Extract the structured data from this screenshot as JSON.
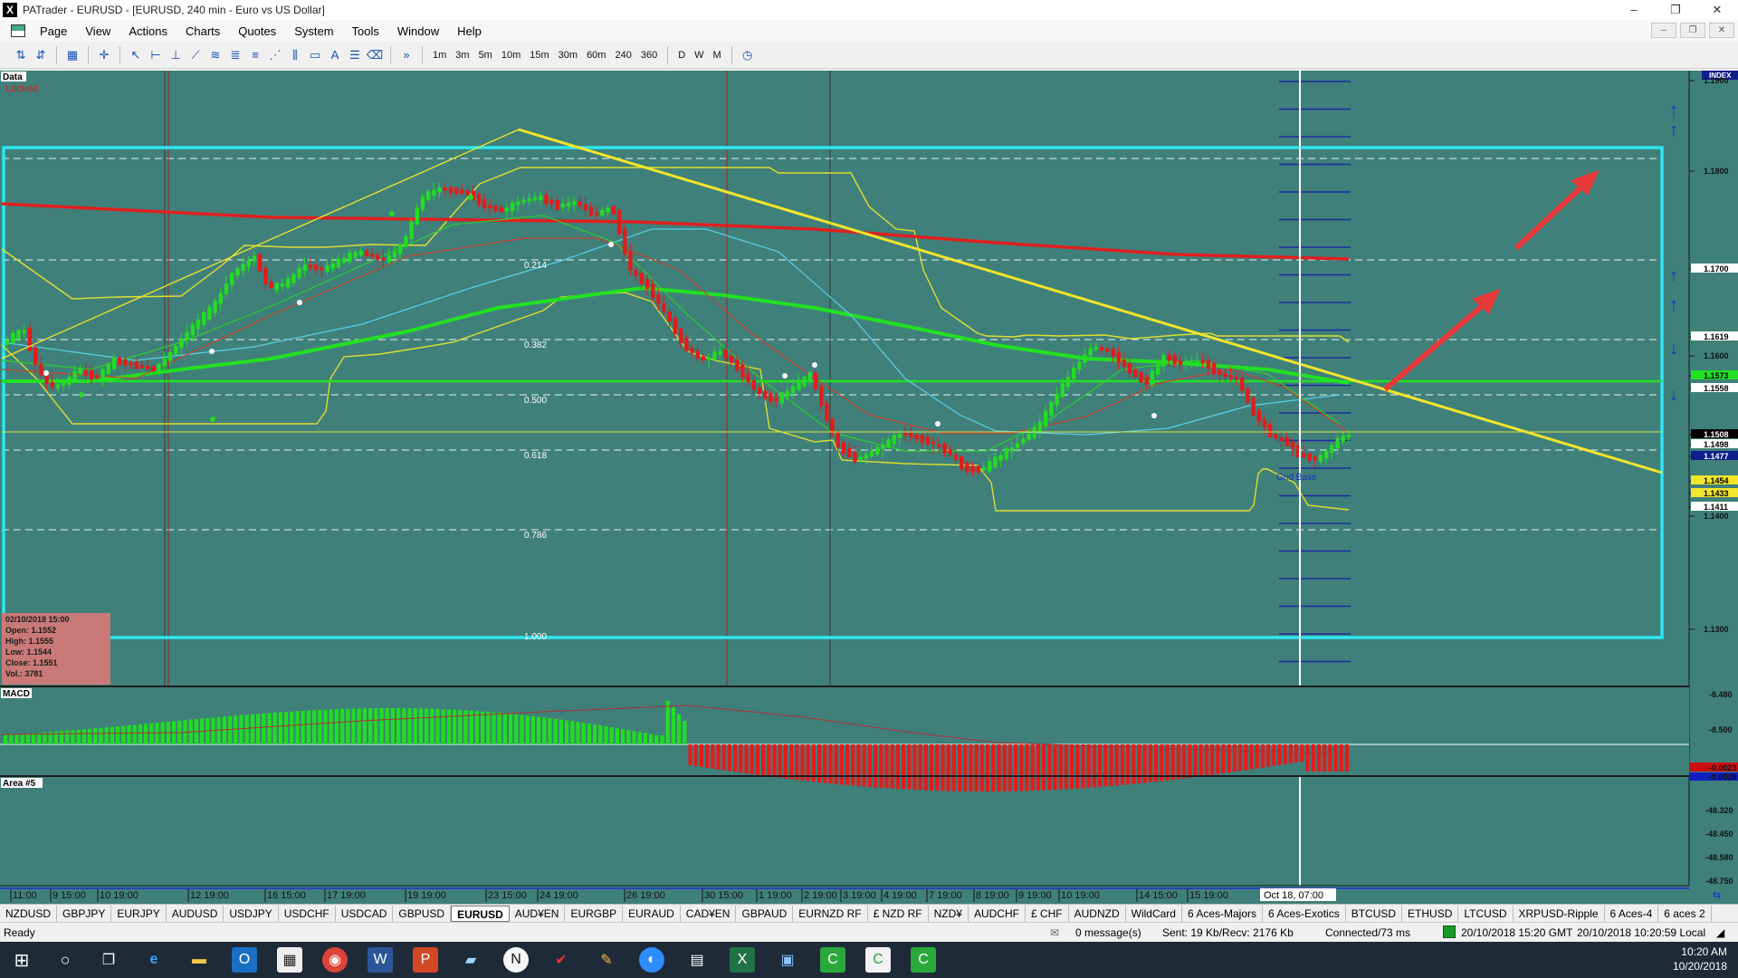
{
  "window": {
    "title": "PATrader - EURUSD - [EURUSD, 240 min - Euro vs US Dollar]",
    "controls": [
      "–",
      "❐",
      "✕"
    ],
    "mdi_controls": [
      "–",
      "❐",
      "✕"
    ]
  },
  "menu": [
    "Page",
    "View",
    "Actions",
    "Charts",
    "Quotes",
    "System",
    "Tools",
    "Window",
    "Help"
  ],
  "toolbar": {
    "timeframes": [
      "1m",
      "3m",
      "5m",
      "10m",
      "15m",
      "30m",
      "60m",
      "240",
      "360",
      "D",
      "W",
      "M"
    ],
    "more": "»"
  },
  "chart": {
    "data_label": "Data",
    "locked_label": "Locked",
    "index_label": "INDEX",
    "fib_levels": [
      "0.214",
      "0.382",
      "0.500",
      "0.618",
      "0.786",
      "1.000"
    ],
    "grid_base_label": "Grid Base",
    "price_axis": [
      "1.1900",
      "1.1800",
      "1.1700",
      "1.1619",
      "1.1600",
      "1.1573",
      "1.1558",
      "1.1508",
      "1.1498",
      "1.1477",
      "1.1454",
      "1.1433",
      "1.1411",
      "1.1400",
      "1.1300"
    ],
    "info_box": {
      "date": "02/10/2018 15:00",
      "open": "Open: 1.1552",
      "high": "High: 1.1555",
      "low": "Low: 1.1544",
      "close": "Close: 1.1551",
      "vol": "Vol.: 3781"
    },
    "macd_label": "MACD",
    "macd_axis": [
      "-8.480",
      "-8.500",
      "-0.0023",
      "-0.0028"
    ],
    "area_label": "Area #5",
    "area_axis": [
      "-48.320",
      "-48.450",
      "-48.580",
      "-48.750"
    ],
    "time_axis": [
      "11:00",
      "9 15:00",
      "10 19:00",
      "12 19:00",
      "16 15:00",
      "17 19:00",
      "19 19:00",
      "23 15:00",
      "24 19:00",
      "26 19:00",
      "30 15:00",
      "1 19:00",
      "2 19:00",
      "3 19:00",
      "4 19:00",
      "7 19:00",
      "8 19:00",
      "9 19:00",
      "10 19:00",
      "14 15:00",
      "15 19:00"
    ],
    "cursor_time": "Oct 18, 07:00"
  },
  "instrument_tabs": [
    "NZDUSD",
    "GBPJPY",
    "EURJPY",
    "AUDUSD",
    "USDJPY",
    "USDCHF",
    "USDCAD",
    "GBPUSD",
    "EURUSD",
    "AUD¥EN",
    "EURGBP",
    "EURAUD",
    "CAD¥EN",
    "GBPAUD",
    "EURNZD RF",
    "£ NZD RF",
    "NZD¥",
    "AUDCHF",
    "£ CHF",
    "AUDNZD",
    "WildCard",
    "6 Aces-Majors",
    "6 Aces-Exotics",
    "BTCUSD",
    "ETHUSD",
    "LTCUSD",
    "XRPUSD-Ripple",
    "6 Aces-4",
    "6 aces 2"
  ],
  "active_tab": "EURUSD",
  "status": {
    "ready": "Ready",
    "messages": "0 message(s)",
    "traffic": "Sent: 19 Kb/Recv: 2176 Kb",
    "connection": "Connected/73 ms",
    "gmt": "20/10/2018 15:20 GMT",
    "local": "20/10/2018 10:20:59 Local"
  },
  "clock": {
    "time": "10:20 AM",
    "date": "10/20/2018"
  },
  "colors": {
    "chart_bg": "#3f807a",
    "bull": "#22dd22",
    "bear": "#e41b1b",
    "trendline": "#f2e52a",
    "range_box": "#2ee6f2",
    "arrow": "#e83a3a"
  }
}
